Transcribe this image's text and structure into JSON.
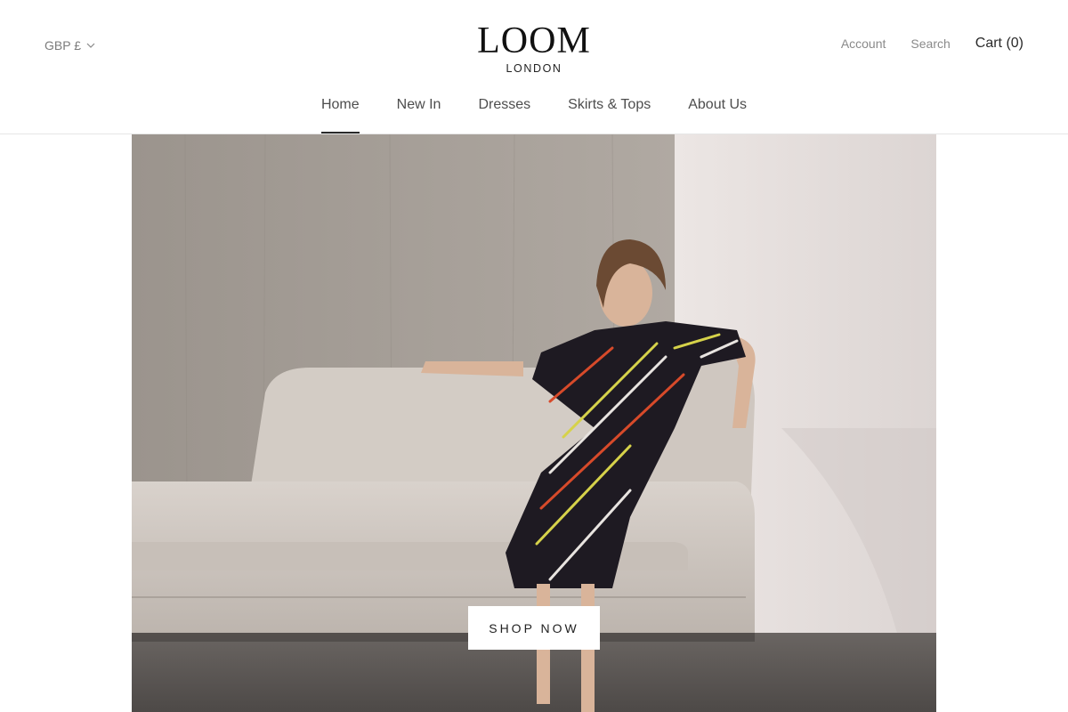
{
  "header": {
    "currency": "GBP £",
    "logo_main": "LOOM",
    "logo_sub": "LONDON",
    "account_label": "Account",
    "search_label": "Search",
    "cart_label": "Cart (0)"
  },
  "nav": {
    "items": [
      {
        "label": "Home",
        "active": true
      },
      {
        "label": "New In",
        "active": false
      },
      {
        "label": "Dresses",
        "active": false
      },
      {
        "label": "Skirts & Tops",
        "active": false
      },
      {
        "label": "About Us",
        "active": false
      }
    ]
  },
  "hero": {
    "image": "model-in-patterned-dress-on-sofa",
    "cta_label": "SHOP NOW"
  },
  "colors": {
    "text": "#2a2a2a",
    "muted": "#8a8a8a",
    "border": "#e6e6e6",
    "button_bg": "#ffffff"
  }
}
